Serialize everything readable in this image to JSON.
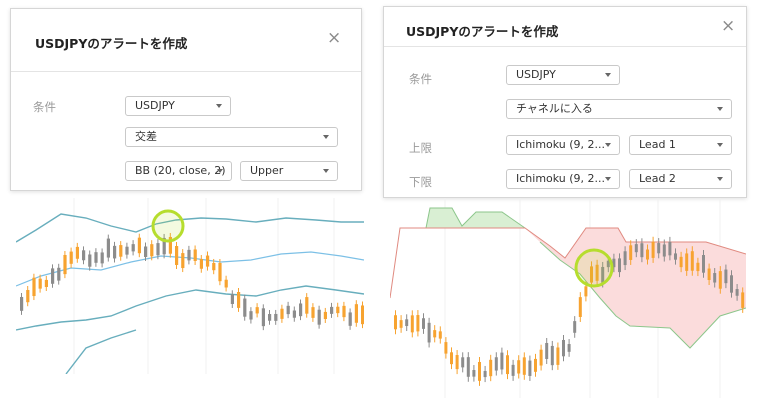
{
  "left_dialog": {
    "title": "USDJPYのアラートを作成",
    "close_symbol": "×",
    "condition_label": "条件",
    "symbol_select": "USDJPY",
    "operator_select": "交差",
    "indicator_select": "BB (20, close, 2)",
    "band_select": "Upper"
  },
  "right_dialog": {
    "title": "USDJPYのアラートを作成",
    "close_symbol": "×",
    "condition_label": "条件",
    "symbol_select": "USDJPY",
    "operator_select": "チャネルに入る",
    "upper_label": "上限",
    "upper_indicator_select": "Ichimoku (9, 2...",
    "upper_line_select": "Lead 1",
    "lower_label": "下限",
    "lower_indicator_select": "Ichimoku (9, 2...",
    "lower_line_select": "Lead 2"
  },
  "colors": {
    "bull_candle": "#f7a330",
    "bear_candle": "#8c8c8c",
    "bollinger_band": "#68aebd",
    "bollinger_mid": "#7cc0e6",
    "kumo_bull_fill": "#d9efd3",
    "kumo_bear_fill": "#fbdcdc",
    "lead1_line": "#e08a80",
    "lead2_line": "#8cc68b",
    "highlight_circle": "#b6dd2d"
  },
  "icons": {
    "close": "close-icon",
    "dropdown": "chevron-down-icon"
  }
}
